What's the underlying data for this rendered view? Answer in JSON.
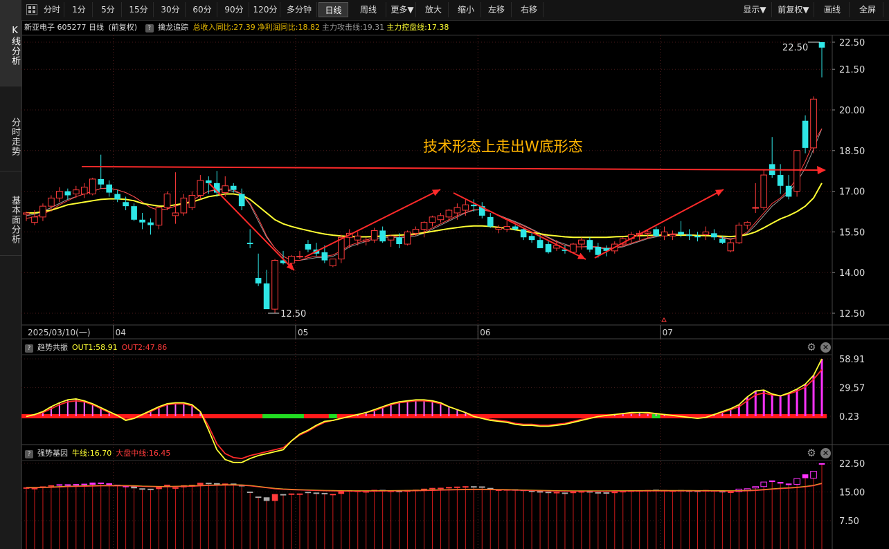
{
  "sidebar": {
    "tabs": [
      {
        "label": "K线分析",
        "active": true
      },
      {
        "label": "分时走势",
        "active": false
      },
      {
        "label": "基本面分析",
        "active": false
      }
    ]
  },
  "toolbar": {
    "left": [
      "分时",
      "1分",
      "5分",
      "15分",
      "30分",
      "60分",
      "90分",
      "120分",
      "多分钟",
      "日线",
      "周线",
      "更多▼",
      "放大",
      "缩小",
      "左移",
      "右移"
    ],
    "active": "日线",
    "right": [
      "显示▼",
      "前复权▼",
      "画线",
      "全屏"
    ]
  },
  "info": {
    "stock": "新亚电子 605277 日线",
    "adjust": "(前复权)",
    "indicator_name": "擒龙追踪",
    "items": [
      {
        "text": "总收入同比:27.39",
        "color": "#e6b800"
      },
      {
        "text": "净利润同比:18.82",
        "color": "#e6b800"
      },
      {
        "text": "主力攻击线:19.31",
        "color": "#999999"
      },
      {
        "text": "主力控盘线:17.38",
        "color": "#ffff33"
      }
    ]
  },
  "main_chart": {
    "y_ticks": [
      "22.50",
      "21.50",
      "20.00",
      "18.50",
      "17.00",
      "15.50",
      "14.00",
      "12.50"
    ],
    "y_range": [
      12.5,
      22.5
    ],
    "date_label": "2025/03/10(一)",
    "month_labels": [
      "04",
      "05",
      "06",
      "07"
    ],
    "annotation": "技术形态上走出W底形态",
    "high_label": "22.50",
    "low_label": "12.50",
    "colors": {
      "up": "#ff3b3b",
      "down": "#2ee6e6",
      "ma_yellow": "#ffff33",
      "ma_gray": "#9a9a9a",
      "arrow": "#ff2a2a",
      "annotation": "#ffb400"
    }
  },
  "panel1": {
    "name": "趋势共振",
    "out1": "OUT1:58.91",
    "out2": "OUT2:47.86",
    "y_ticks": [
      "58.91",
      "29.57",
      "0.23"
    ]
  },
  "panel2": {
    "name": "强势基因",
    "l1": "牛线:16.70",
    "l2": "大盘中线:16.45",
    "y_ticks": [
      "22.50",
      "15.00",
      "7.50"
    ]
  },
  "chart_data": {
    "type": "candlestick",
    "period": "日线",
    "symbol": "605277",
    "y_range": [
      12.5,
      22.5
    ],
    "ohlc": [
      [
        16.15,
        16.25,
        15.9,
        16.2
      ],
      [
        15.85,
        16.3,
        15.75,
        16.05
      ],
      [
        16.05,
        16.55,
        15.9,
        16.45
      ],
      [
        16.45,
        16.85,
        16.25,
        16.75
      ],
      [
        16.75,
        17.15,
        16.6,
        17.0
      ],
      [
        17.0,
        17.1,
        16.7,
        16.85
      ],
      [
        16.9,
        17.2,
        16.75,
        17.05
      ],
      [
        16.9,
        17.3,
        16.75,
        17.15
      ],
      [
        16.9,
        17.5,
        16.85,
        17.45
      ],
      [
        17.45,
        18.35,
        17.1,
        17.25
      ],
      [
        17.25,
        17.4,
        16.8,
        16.95
      ],
      [
        16.9,
        17.05,
        16.6,
        16.7
      ],
      [
        16.6,
        16.8,
        16.3,
        16.45
      ],
      [
        16.45,
        16.55,
        15.9,
        15.95
      ],
      [
        15.95,
        16.2,
        15.6,
        15.85
      ],
      [
        15.85,
        16.0,
        15.4,
        15.75
      ],
      [
        15.75,
        16.45,
        15.6,
        16.4
      ],
      [
        16.4,
        17.0,
        16.3,
        16.9
      ],
      [
        16.1,
        17.7,
        15.8,
        16.2
      ],
      [
        16.2,
        16.9,
        16.1,
        16.75
      ],
      [
        16.4,
        17.0,
        16.3,
        16.85
      ],
      [
        16.85,
        17.6,
        16.7,
        17.4
      ],
      [
        17.4,
        17.55,
        16.9,
        17.3
      ],
      [
        17.3,
        17.75,
        16.8,
        16.95
      ],
      [
        16.95,
        17.55,
        16.8,
        17.2
      ],
      [
        17.2,
        17.3,
        16.95,
        17.05
      ],
      [
        16.9,
        17.1,
        16.3,
        16.45
      ],
      [
        15.1,
        15.6,
        14.9,
        15.05
      ],
      [
        13.8,
        14.7,
        13.5,
        13.6
      ],
      [
        13.6,
        14.1,
        13.0,
        12.65
      ],
      [
        12.65,
        14.5,
        12.5,
        14.45
      ],
      [
        14.45,
        14.8,
        14.3,
        14.35
      ],
      [
        14.35,
        14.65,
        14.1,
        14.6
      ],
      [
        14.6,
        14.8,
        14.5,
        14.6
      ],
      [
        15.05,
        15.2,
        14.75,
        14.85
      ],
      [
        14.85,
        15.1,
        14.6,
        14.7
      ],
      [
        14.75,
        15.0,
        14.35,
        14.45
      ],
      [
        14.25,
        14.5,
        14.2,
        14.5
      ],
      [
        14.5,
        15.4,
        14.35,
        15.3
      ],
      [
        15.3,
        15.6,
        14.9,
        15.45
      ],
      [
        15.2,
        15.5,
        15.0,
        15.35
      ],
      [
        15.15,
        15.3,
        15.0,
        15.2
      ],
      [
        15.2,
        15.65,
        15.1,
        15.55
      ],
      [
        15.55,
        15.7,
        15.1,
        15.15
      ],
      [
        15.2,
        15.4,
        14.95,
        15.35
      ],
      [
        15.3,
        15.45,
        14.9,
        15.05
      ],
      [
        15.05,
        15.55,
        15.0,
        15.5
      ],
      [
        15.45,
        15.7,
        15.35,
        15.6
      ],
      [
        15.6,
        15.9,
        15.3,
        15.85
      ],
      [
        15.85,
        16.1,
        15.7,
        16.05
      ],
      [
        15.95,
        16.2,
        15.85,
        16.1
      ],
      [
        16.05,
        16.35,
        15.9,
        16.3
      ],
      [
        16.2,
        16.55,
        15.95,
        16.4
      ],
      [
        16.3,
        16.7,
        16.1,
        16.5
      ],
      [
        16.5,
        16.7,
        16.25,
        16.45
      ],
      [
        16.45,
        16.6,
        16.0,
        16.1
      ],
      [
        16.05,
        16.2,
        15.65,
        15.7
      ],
      [
        15.6,
        15.75,
        15.45,
        15.65
      ],
      [
        15.6,
        15.9,
        15.5,
        15.7
      ],
      [
        15.7,
        15.75,
        15.55,
        15.6
      ],
      [
        15.6,
        15.65,
        15.2,
        15.3
      ],
      [
        15.35,
        15.5,
        15.1,
        15.2
      ],
      [
        15.2,
        15.4,
        14.95,
        14.9
      ],
      [
        15.05,
        15.15,
        14.7,
        14.75
      ],
      [
        14.9,
        15.2,
        14.8,
        15.0
      ],
      [
        14.85,
        15.0,
        14.7,
        14.8
      ],
      [
        14.75,
        15.1,
        14.7,
        15.05
      ],
      [
        15.05,
        15.3,
        14.85,
        15.2
      ],
      [
        15.2,
        15.3,
        14.75,
        14.85
      ],
      [
        14.95,
        15.1,
        14.55,
        14.65
      ],
      [
        14.9,
        15.0,
        14.6,
        14.8
      ],
      [
        14.8,
        15.15,
        14.7,
        15.05
      ],
      [
        15.05,
        15.3,
        14.95,
        15.25
      ],
      [
        15.25,
        15.5,
        15.1,
        15.4
      ],
      [
        15.4,
        15.55,
        15.2,
        15.45
      ],
      [
        15.45,
        15.6,
        15.25,
        15.5
      ],
      [
        15.6,
        15.7,
        15.3,
        15.35
      ],
      [
        15.35,
        15.7,
        15.2,
        15.5
      ],
      [
        15.35,
        15.55,
        15.2,
        15.4
      ],
      [
        15.5,
        15.9,
        15.3,
        15.4
      ],
      [
        15.4,
        15.6,
        15.2,
        15.35
      ],
      [
        15.35,
        15.5,
        15.15,
        15.3
      ],
      [
        15.4,
        15.7,
        15.2,
        15.5
      ],
      [
        15.45,
        15.6,
        15.2,
        15.3
      ],
      [
        15.25,
        15.35,
        15.05,
        15.1
      ],
      [
        14.8,
        15.2,
        14.75,
        15.1
      ],
      [
        15.1,
        15.85,
        15.05,
        15.75
      ],
      [
        15.75,
        15.9,
        15.6,
        15.85
      ],
      [
        16.4,
        17.3,
        16.2,
        16.4
      ],
      [
        16.4,
        17.8,
        16.3,
        17.6
      ],
      [
        18.0,
        19.0,
        17.5,
        17.6
      ],
      [
        17.6,
        18.0,
        16.9,
        17.2
      ],
      [
        17.2,
        17.6,
        16.7,
        16.8
      ],
      [
        17.0,
        18.0,
        16.8,
        18.5
      ],
      [
        19.6,
        19.8,
        18.4,
        18.6
      ],
      [
        18.6,
        20.5,
        18.4,
        20.4
      ],
      [
        22.5,
        22.5,
        21.2,
        22.3
      ]
    ],
    "ma_yellow": [
      16.2,
      16.2,
      16.25,
      16.3,
      16.4,
      16.5,
      16.55,
      16.6,
      16.65,
      16.7,
      16.72,
      16.72,
      16.7,
      16.65,
      16.55,
      16.5,
      16.45,
      16.45,
      16.5,
      16.55,
      16.6,
      16.7,
      16.8,
      16.85,
      16.9,
      16.9,
      16.85,
      16.7,
      16.45,
      16.2,
      15.95,
      15.8,
      15.7,
      15.62,
      15.55,
      15.48,
      15.42,
      15.38,
      15.35,
      15.33,
      15.32,
      15.32,
      15.33,
      15.35,
      15.37,
      15.38,
      15.4,
      15.43,
      15.47,
      15.52,
      15.57,
      15.62,
      15.66,
      15.7,
      15.72,
      15.72,
      15.7,
      15.67,
      15.63,
      15.58,
      15.53,
      15.48,
      15.43,
      15.38,
      15.35,
      15.32,
      15.3,
      15.3,
      15.3,
      15.3,
      15.3,
      15.32,
      15.33,
      15.35,
      15.36,
      15.37,
      15.38,
      15.38,
      15.38,
      15.38,
      15.38,
      15.37,
      15.36,
      15.35,
      15.34,
      15.33,
      15.35,
      15.4,
      15.5,
      15.65,
      15.82,
      15.98,
      16.1,
      16.25,
      16.45,
      16.75,
      17.3
    ],
    "ma_gray": [
      16.1,
      16.15,
      16.25,
      16.4,
      16.55,
      16.7,
      16.8,
      16.9,
      17.0,
      17.1,
      17.1,
      17.05,
      16.95,
      16.8,
      16.6,
      16.4,
      16.3,
      16.35,
      16.45,
      16.55,
      16.65,
      16.85,
      17.0,
      17.05,
      17.05,
      17.0,
      16.9,
      16.5,
      15.9,
      15.3,
      14.9,
      14.6,
      14.45,
      14.45,
      14.5,
      14.55,
      14.55,
      14.6,
      14.75,
      14.95,
      15.05,
      15.15,
      15.25,
      15.3,
      15.3,
      15.28,
      15.3,
      15.35,
      15.45,
      15.6,
      15.75,
      15.9,
      16.05,
      16.2,
      16.3,
      16.32,
      16.25,
      16.12,
      16.0,
      15.88,
      15.75,
      15.6,
      15.45,
      15.3,
      15.15,
      15.05,
      14.95,
      14.95,
      14.95,
      14.9,
      14.88,
      14.9,
      14.95,
      15.05,
      15.15,
      15.25,
      15.32,
      15.38,
      15.42,
      15.42,
      15.4,
      15.38,
      15.38,
      15.36,
      15.3,
      15.25,
      15.3,
      15.45,
      15.75,
      16.1,
      16.45,
      16.7,
      16.95,
      17.35,
      17.85,
      18.55,
      19.31
    ],
    "ma_red": [
      16.0,
      16.05,
      16.15,
      16.3,
      16.5,
      16.65,
      16.8,
      16.9,
      17.0,
      17.1,
      17.12,
      17.05,
      16.95,
      16.8,
      16.6,
      16.4,
      16.3,
      16.35,
      16.45,
      16.55,
      16.65,
      16.85,
      17.0,
      17.08,
      17.1,
      17.05,
      16.9,
      16.55,
      16.0,
      15.35,
      14.9,
      14.6,
      14.45,
      14.45,
      14.55,
      14.6,
      14.6,
      14.65,
      14.8,
      15.0,
      15.1,
      15.2,
      15.3,
      15.35,
      15.35,
      15.3,
      15.35,
      15.4,
      15.5,
      15.65,
      15.8,
      15.95,
      16.1,
      16.22,
      16.32,
      16.32,
      16.25,
      16.1,
      15.98,
      15.85,
      15.72,
      15.58,
      15.42,
      15.28,
      15.12,
      15.0,
      14.95,
      14.95,
      14.97,
      14.95,
      14.9,
      14.92,
      14.98,
      15.08,
      15.18,
      15.28,
      15.35,
      15.4,
      15.43,
      15.42,
      15.4,
      15.38,
      15.38,
      15.35,
      15.28,
      15.22,
      15.32,
      15.5,
      15.85,
      16.2,
      16.55,
      16.75,
      17.05,
      17.5,
      18.1,
      18.8,
      19.31
    ],
    "panel1": {
      "name": "趋势共振",
      "y_ticks": [
        58.91,
        29.57,
        0.23
      ],
      "out1_last": 58.91,
      "out2_last": 47.86,
      "out1": [
        0,
        2,
        5,
        10,
        14,
        17,
        18,
        16,
        13,
        9,
        5,
        1,
        -4,
        -2,
        2,
        6,
        10,
        13,
        14,
        14,
        12,
        5,
        -14,
        -34,
        -44,
        -47,
        -47,
        -43,
        -40,
        -38,
        -36,
        -34,
        -25,
        -18,
        -14,
        -9,
        -5,
        -4,
        -2,
        0,
        2,
        4,
        7,
        10,
        13,
        15,
        16,
        17,
        17,
        16,
        14,
        10,
        7,
        4,
        0,
        -2,
        -4,
        -5,
        -6,
        -8,
        -9,
        -9,
        -10,
        -10,
        -9,
        -8,
        -6,
        -4,
        -2,
        0,
        1,
        2,
        3,
        4,
        4,
        4,
        3,
        2,
        1,
        0,
        -1,
        -2,
        -1,
        2,
        5,
        8,
        12,
        20,
        26,
        27,
        23,
        21,
        24,
        28,
        33,
        42,
        58.91
      ],
      "out2": [
        0,
        1,
        4,
        8,
        12,
        15,
        16,
        15,
        12,
        8,
        4,
        1,
        -3,
        -2,
        1,
        5,
        9,
        12,
        13,
        13,
        11,
        5,
        -10,
        -28,
        -38,
        -42,
        -43,
        -40,
        -38,
        -36,
        -34,
        -32,
        -25,
        -19,
        -15,
        -10,
        -6,
        -4,
        -2,
        0,
        2,
        4,
        6,
        9,
        12,
        14,
        15,
        16,
        16,
        15,
        13,
        10,
        7,
        4,
        1,
        -1,
        -3,
        -4,
        -5,
        -7,
        -8,
        -8,
        -9,
        -9,
        -8,
        -7,
        -5,
        -3,
        -2,
        0,
        1,
        2,
        3,
        3,
        4,
        3,
        3,
        2,
        1,
        0,
        -1,
        -1,
        0,
        2,
        4,
        7,
        10,
        16,
        22,
        24,
        22,
        21,
        23,
        26,
        30,
        38,
        47.86
      ]
    },
    "panel2": {
      "name": "强势基因",
      "y_ticks": [
        22.5,
        15.0,
        7.5
      ],
      "bull_last": 16.7,
      "market_mid_last": 16.45
    }
  }
}
